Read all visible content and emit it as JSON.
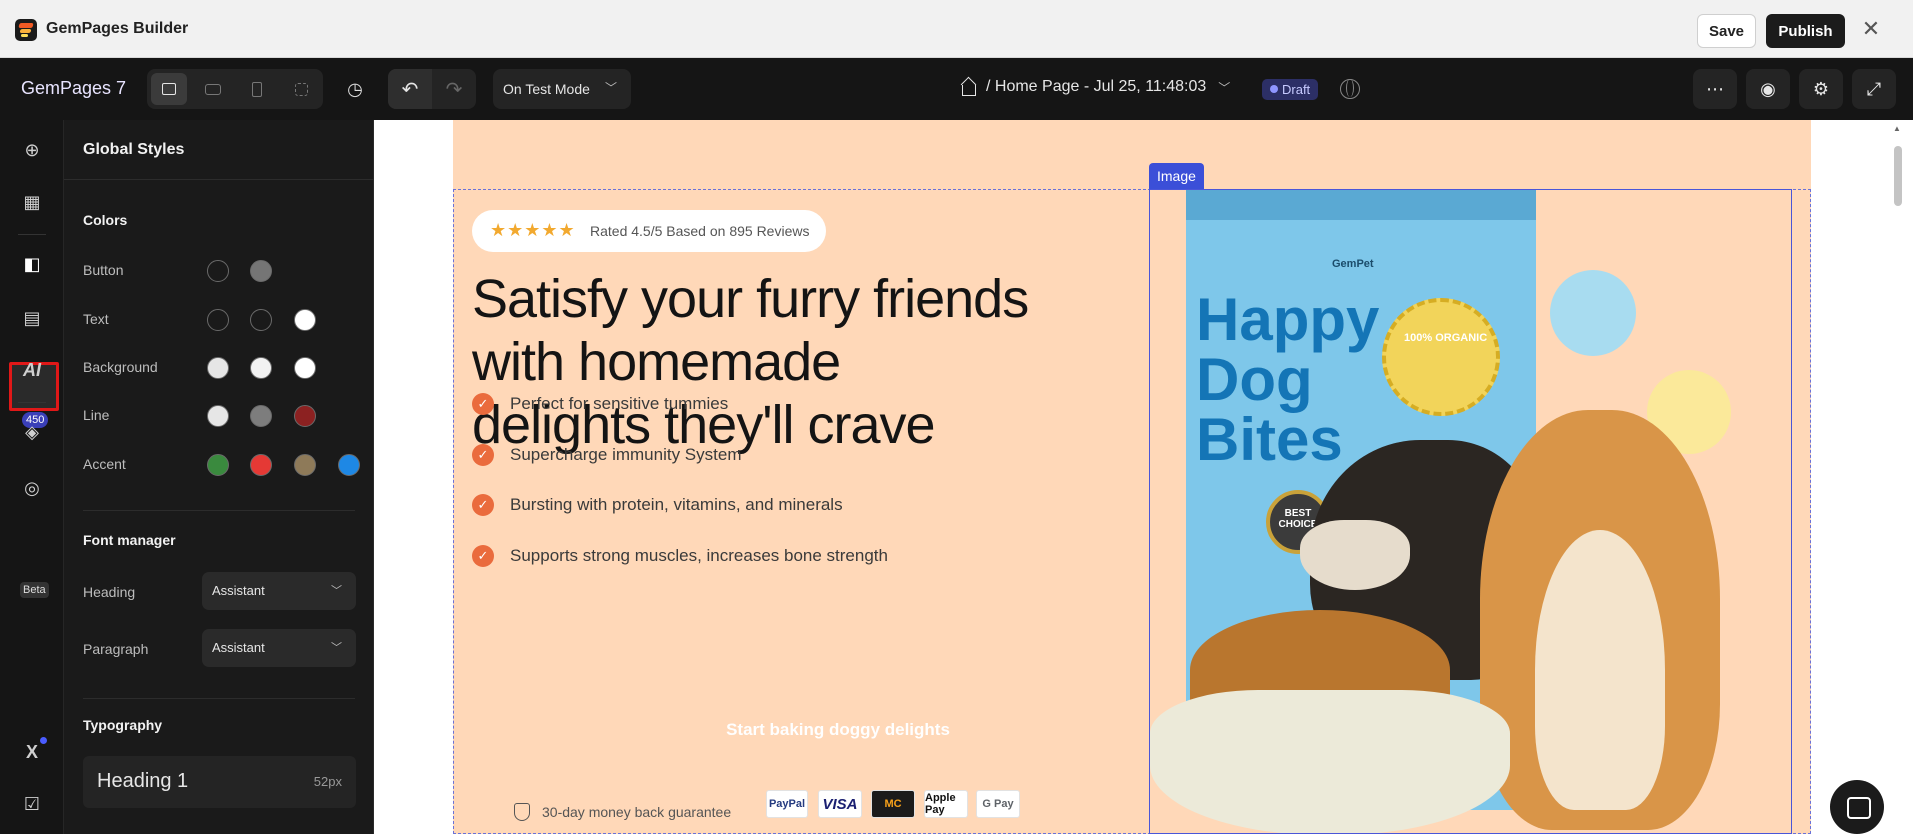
{
  "window": {
    "title": "GemPages Builder",
    "save_label": "Save",
    "publish_label": "Publish",
    "close_glyph": "✕"
  },
  "topbar": {
    "brand": "GemPages 7",
    "mode": "On Test Mode",
    "page_title": "/ Home Page - Jul 25, 11:48:03",
    "status": "Draft",
    "more_glyph": "⋯",
    "preview_glyph": "◉",
    "settings_glyph": "⚙",
    "expand_glyph": "⤢"
  },
  "rail": {
    "badge": "450",
    "beta": "Beta"
  },
  "panel": {
    "title": "Global Styles",
    "colors_title": "Colors",
    "color_rows": [
      {
        "label": "Button",
        "swatches": [
          "#1a1a1a",
          "#757575"
        ]
      },
      {
        "label": "Text",
        "swatches": [
          "#1a1a1a",
          "#1a1a1a",
          "#ffffff"
        ]
      },
      {
        "label": "Background",
        "swatches": [
          "#e6e6e6",
          "#f2f2f2",
          "#ffffff"
        ]
      },
      {
        "label": "Line",
        "swatches": [
          "#e6e6e6",
          "#7d7d7d",
          "#8c2121"
        ]
      },
      {
        "label": "Accent",
        "swatches": [
          "#3a8a3e",
          "#e53935",
          "#8e7a59",
          "#1e88e5"
        ]
      }
    ],
    "font_manager_title": "Font manager",
    "heading_label": "Heading",
    "heading_font": "Assistant",
    "paragraph_label": "Paragraph",
    "paragraph_font": "Assistant",
    "typography_title": "Typography",
    "typo_name": "Heading 1",
    "typo_size": "52px"
  },
  "canvas": {
    "review_stars": "★★★★★",
    "review_text": "Rated 4.5/5 Based on 895 Reviews",
    "headline": "Satisfy your furry friends with homemade delights they'll crave",
    "benefits": [
      "Perfect for sensitive tummies",
      "Supercharge immunity System",
      "Bursting with protein, vitamins, and minerals",
      "Supports strong muscles, increases bone strength"
    ],
    "cta": "Start baking doggy delights",
    "guarantee": "30-day money back guarantee",
    "payments": [
      "PayPal",
      "VISA",
      "MC",
      "Apple Pay",
      "G Pay"
    ],
    "image_tag": "Image",
    "product": {
      "brand": "GemPet",
      "name_lines": [
        "Happy",
        "Dog",
        "Bites"
      ],
      "organic": "100% ORGANIC",
      "badge": "BEST CHOICE"
    }
  }
}
